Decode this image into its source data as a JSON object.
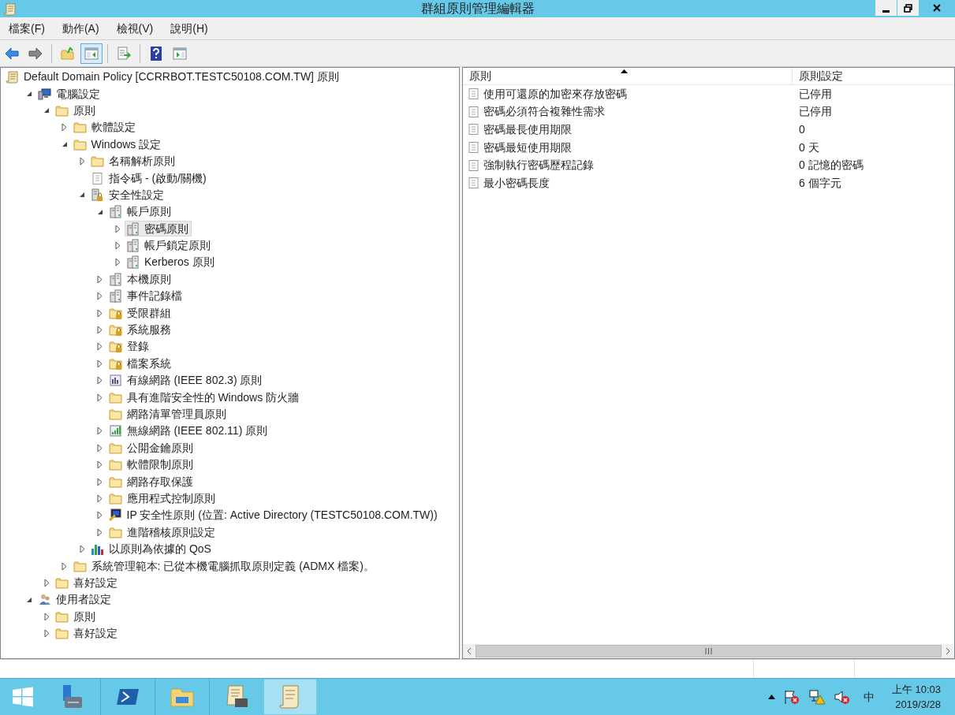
{
  "window": {
    "title": "群組原則管理編輯器"
  },
  "menu": [
    {
      "label": "檔案(F)"
    },
    {
      "label": "動作(A)"
    },
    {
      "label": "檢視(V)"
    },
    {
      "label": "說明(H)"
    }
  ],
  "toolbar": [
    {
      "kind": "back",
      "pressed": false
    },
    {
      "kind": "forward",
      "pressed": false
    },
    {
      "kind": "sep"
    },
    {
      "kind": "up",
      "pressed": false
    },
    {
      "kind": "tree",
      "pressed": true
    },
    {
      "kind": "sep"
    },
    {
      "kind": "export",
      "pressed": false
    },
    {
      "kind": "sep"
    },
    {
      "kind": "help",
      "pressed": false
    },
    {
      "kind": "pane",
      "pressed": false
    }
  ],
  "tree": [
    {
      "label": "Default Domain Policy [CCRRBOT.TESTC50108.COM.TW] 原則",
      "kind": "scroll",
      "selected": false,
      "children": [
        {
          "label": "電腦設定",
          "kind": "computer",
          "expanded": true,
          "selected": false,
          "children": [
            {
              "label": "原則",
              "kind": "folder",
              "expanded": true,
              "selected": false,
              "children": [
                {
                  "label": "軟體設定",
                  "kind": "folder",
                  "expanded": false,
                  "selected": false
                },
                {
                  "label": "Windows 設定",
                  "kind": "folder",
                  "expanded": true,
                  "selected": false,
                  "children": [
                    {
                      "label": "名稱解析原則",
                      "kind": "folder",
                      "expanded": false,
                      "selected": false
                    },
                    {
                      "label": "指令碼 - (啟動/關機)",
                      "kind": "script",
                      "selected": false
                    },
                    {
                      "label": "安全性設定",
                      "kind": "security",
                      "expanded": true,
                      "selected": false,
                      "children": [
                        {
                          "label": "帳戶原則",
                          "kind": "policy",
                          "expanded": true,
                          "selected": false,
                          "children": [
                            {
                              "label": "密碼原則",
                              "kind": "policy",
                              "expanded": false,
                              "selected": true
                            },
                            {
                              "label": "帳戶鎖定原則",
                              "kind": "policy",
                              "expanded": false,
                              "selected": false
                            },
                            {
                              "label": "Kerberos 原則",
                              "kind": "policy",
                              "expanded": false,
                              "selected": false
                            }
                          ]
                        },
                        {
                          "label": "本機原則",
                          "kind": "policy",
                          "expanded": false,
                          "selected": false
                        },
                        {
                          "label": "事件記錄檔",
                          "kind": "policy",
                          "expanded": false,
                          "selected": false
                        },
                        {
                          "label": "受限群組",
                          "kind": "lockfolder",
                          "expanded": false,
                          "selected": false
                        },
                        {
                          "label": "系統服務",
                          "kind": "lockfolder",
                          "expanded": false,
                          "selected": false
                        },
                        {
                          "label": "登錄",
                          "kind": "lockfolder",
                          "expanded": false,
                          "selected": false
                        },
                        {
                          "label": "檔案系統",
                          "kind": "lockfolder",
                          "expanded": false,
                          "selected": false
                        },
                        {
                          "label": "有線網路 (IEEE 802.3) 原則",
                          "kind": "wired",
                          "expanded": false,
                          "selected": false
                        },
                        {
                          "label": "具有進階安全性的 Windows 防火牆",
                          "kind": "folder",
                          "expanded": false,
                          "selected": false
                        },
                        {
                          "label": "網路清單管理員原則",
                          "kind": "folder",
                          "selected": false
                        },
                        {
                          "label": "無線網路 (IEEE 802.11) 原則",
                          "kind": "wireless",
                          "expanded": false,
                          "selected": false
                        },
                        {
                          "label": "公開金鑰原則",
                          "kind": "folder",
                          "expanded": false,
                          "selected": false
                        },
                        {
                          "label": "軟體限制原則",
                          "kind": "folder",
                          "expanded": false,
                          "selected": false
                        },
                        {
                          "label": "網路存取保護",
                          "kind": "folder",
                          "expanded": false,
                          "selected": false
                        },
                        {
                          "label": "應用程式控制原則",
                          "kind": "folder",
                          "expanded": false,
                          "selected": false
                        },
                        {
                          "label": "IP 安全性原則 (位置: Active Directory (TESTC50108.COM.TW))",
                          "kind": "ipsec",
                          "expanded": false,
                          "selected": false
                        },
                        {
                          "label": "進階稽核原則設定",
                          "kind": "folder",
                          "expanded": false,
                          "selected": false
                        }
                      ]
                    },
                    {
                      "label": "以原則為依據的 QoS",
                      "kind": "chart",
                      "expanded": false,
                      "selected": false
                    }
                  ]
                },
                {
                  "label": "系統管理範本: 已從本機電腦抓取原則定義 (ADMX 檔案)。",
                  "kind": "folder",
                  "expanded": false,
                  "selected": false
                }
              ]
            },
            {
              "label": "喜好設定",
              "kind": "folder",
              "expanded": false,
              "selected": false
            }
          ]
        },
        {
          "label": "使用者設定",
          "kind": "user",
          "expanded": true,
          "selected": false,
          "children": [
            {
              "label": "原則",
              "kind": "folder",
              "expanded": false,
              "selected": false
            },
            {
              "label": "喜好設定",
              "kind": "folder",
              "expanded": false,
              "selected": false
            }
          ]
        }
      ]
    }
  ],
  "list": {
    "columns": [
      {
        "label": "原則",
        "sorted": true
      },
      {
        "label": "原則設定",
        "sorted": false
      }
    ],
    "rows": [
      {
        "policy": "使用可還原的加密來存放密碼",
        "setting": "已停用"
      },
      {
        "policy": "密碼必須符合複雜性需求",
        "setting": "已停用"
      },
      {
        "policy": "密碼最長使用期限",
        "setting": "0"
      },
      {
        "policy": "密碼最短使用期限",
        "setting": "0 天"
      },
      {
        "policy": "強制執行密碼歷程記錄",
        "setting": "0 記憶的密碼"
      },
      {
        "policy": "最小密碼長度",
        "setting": "6 個字元"
      }
    ]
  },
  "taskbar": {
    "apps": [
      {
        "kind": "start",
        "active": false
      },
      {
        "kind": "server",
        "active": false
      },
      {
        "kind": "shell",
        "active": false
      },
      {
        "kind": "explorer",
        "active": false
      },
      {
        "kind": "toolscroll",
        "active": false
      },
      {
        "kind": "scroll",
        "active": true
      }
    ],
    "ime": "中",
    "time": "上午 10:03",
    "date": "2019/3/28"
  }
}
